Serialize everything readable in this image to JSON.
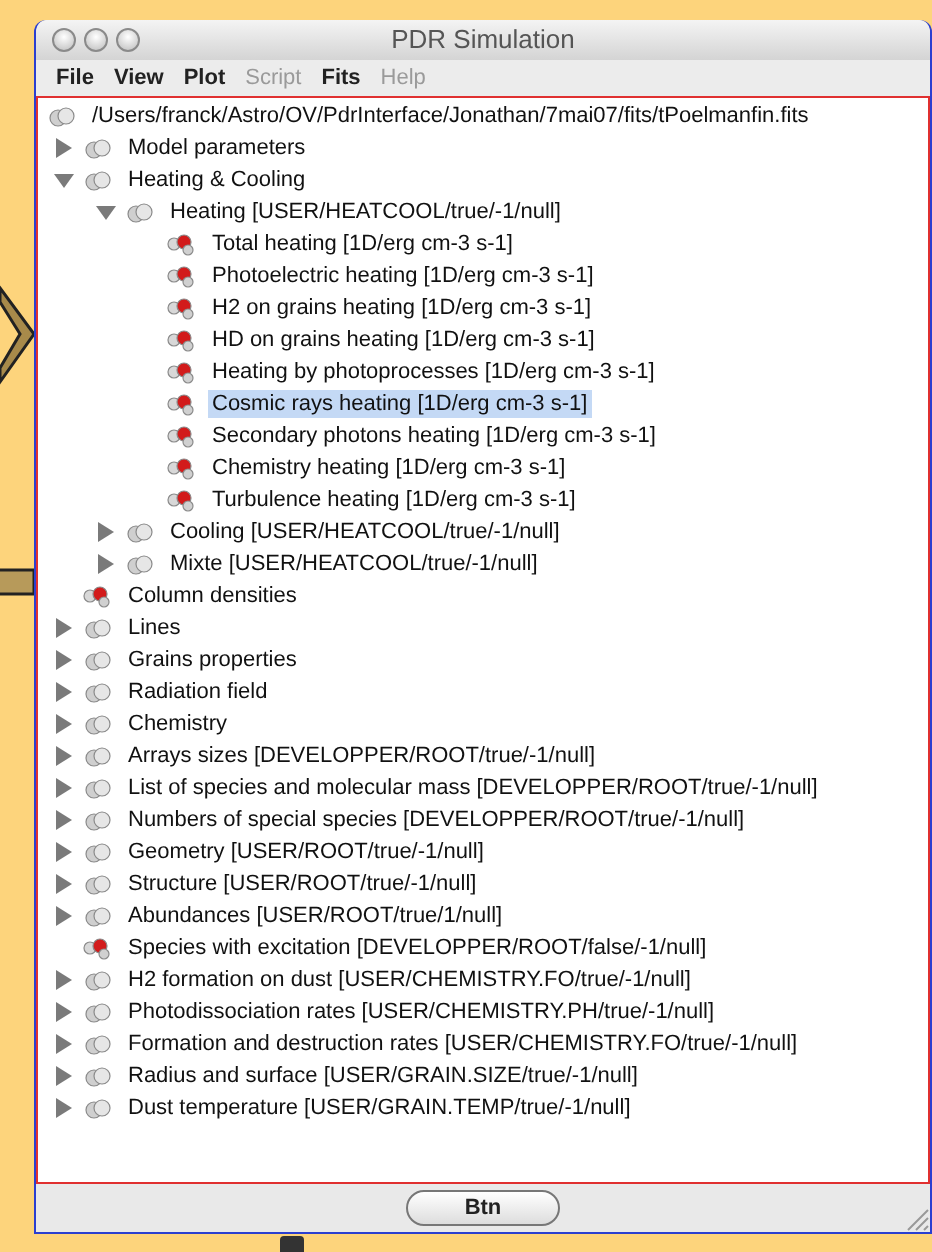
{
  "window": {
    "title": "PDR Simulation"
  },
  "menu": [
    {
      "label": "File",
      "disabled": false
    },
    {
      "label": "View",
      "disabled": false
    },
    {
      "label": "Plot",
      "disabled": false
    },
    {
      "label": "Script",
      "disabled": true
    },
    {
      "label": "Fits",
      "disabled": false
    },
    {
      "label": "Help",
      "disabled": true
    }
  ],
  "tree": {
    "label": "/Users/franck/Astro/OV/PdrInterface/Jonathan/7mai07/fits/tPoelmanfin.fits",
    "kind": "group",
    "selected": false,
    "children": [
      {
        "label": "Model parameters",
        "kind": "group",
        "expanded": false,
        "selected": false
      },
      {
        "label": "Heating & Cooling",
        "kind": "group",
        "expanded": true,
        "selected": false,
        "children": [
          {
            "label": "Heating [USER/HEATCOOL/true/-1/null]",
            "kind": "group",
            "expanded": true,
            "selected": false,
            "children": [
              {
                "label": "Total heating [1D/erg cm-3 s-1]",
                "kind": "leaf",
                "selected": false
              },
              {
                "label": "Photoelectric heating [1D/erg cm-3 s-1]",
                "kind": "leaf",
                "selected": false
              },
              {
                "label": "H2 on grains heating [1D/erg cm-3 s-1]",
                "kind": "leaf",
                "selected": false
              },
              {
                "label": "HD on grains heating [1D/erg cm-3 s-1]",
                "kind": "leaf",
                "selected": false
              },
              {
                "label": "Heating by photoprocesses [1D/erg cm-3 s-1]",
                "kind": "leaf",
                "selected": false
              },
              {
                "label": "Cosmic rays heating [1D/erg cm-3 s-1]",
                "kind": "leaf",
                "selected": true
              },
              {
                "label": "Secondary photons heating [1D/erg cm-3 s-1]",
                "kind": "leaf",
                "selected": false
              },
              {
                "label": "Chemistry heating [1D/erg cm-3 s-1]",
                "kind": "leaf",
                "selected": false
              },
              {
                "label": "Turbulence heating [1D/erg cm-3 s-1]",
                "kind": "leaf",
                "selected": false
              }
            ]
          },
          {
            "label": "Cooling [USER/HEATCOOL/true/-1/null]",
            "kind": "group",
            "expanded": false,
            "selected": false
          },
          {
            "label": "Mixte [USER/HEATCOOL/true/-1/null]",
            "kind": "group",
            "expanded": false,
            "selected": false
          }
        ]
      },
      {
        "label": "Column densities",
        "kind": "leaf",
        "selected": false
      },
      {
        "label": "Lines",
        "kind": "group",
        "expanded": false,
        "selected": false
      },
      {
        "label": "Grains properties",
        "kind": "group",
        "expanded": false,
        "selected": false
      },
      {
        "label": "Radiation field",
        "kind": "group",
        "expanded": false,
        "selected": false
      },
      {
        "label": "Chemistry",
        "kind": "group",
        "expanded": false,
        "selected": false
      },
      {
        "label": "Arrays sizes [DEVELOPPER/ROOT/true/-1/null]",
        "kind": "group",
        "expanded": false,
        "selected": false
      },
      {
        "label": "List of species and molecular mass [DEVELOPPER/ROOT/true/-1/null]",
        "kind": "group",
        "expanded": false,
        "selected": false
      },
      {
        "label": "Numbers of special species [DEVELOPPER/ROOT/true/-1/null]",
        "kind": "group",
        "expanded": false,
        "selected": false
      },
      {
        "label": "Geometry [USER/ROOT/true/-1/null]",
        "kind": "group",
        "expanded": false,
        "selected": false
      },
      {
        "label": "Structure [USER/ROOT/true/-1/null]",
        "kind": "group",
        "expanded": false,
        "selected": false
      },
      {
        "label": "Abundances [USER/ROOT/true/1/null]",
        "kind": "group",
        "expanded": false,
        "selected": false
      },
      {
        "label": "Species with excitation [DEVELOPPER/ROOT/false/-1/null]",
        "kind": "leaf",
        "selected": false
      },
      {
        "label": "H2 formation on dust [USER/CHEMISTRY.FO/true/-1/null]",
        "kind": "group",
        "expanded": false,
        "selected": false
      },
      {
        "label": "Photodissociation rates [USER/CHEMISTRY.PH/true/-1/null]",
        "kind": "group",
        "expanded": false,
        "selected": false
      },
      {
        "label": "Formation and destruction rates [USER/CHEMISTRY.FO/true/-1/null]",
        "kind": "group",
        "expanded": false,
        "selected": false
      },
      {
        "label": "Radius and surface [USER/GRAIN.SIZE/true/-1/null]",
        "kind": "group",
        "expanded": false,
        "selected": false
      },
      {
        "label": "Dust temperature [USER/GRAIN.TEMP/true/-1/null]",
        "kind": "group",
        "expanded": false,
        "selected": false
      }
    ]
  },
  "footer": {
    "button": "Btn"
  }
}
